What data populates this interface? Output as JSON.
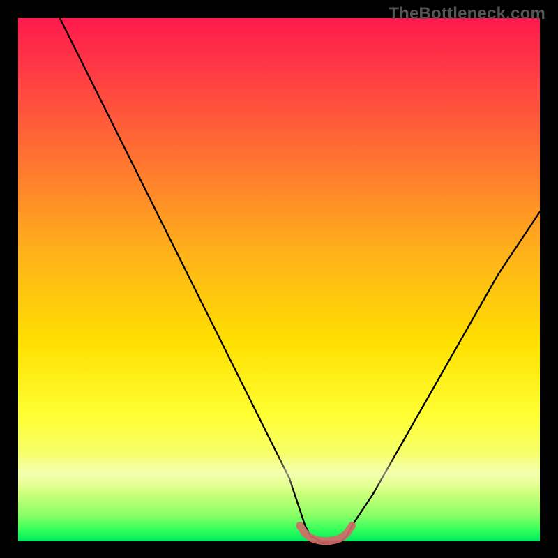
{
  "watermark": "TheBottleneck.com",
  "chart_data": {
    "type": "line",
    "title": "",
    "xlabel": "",
    "ylabel": "",
    "xlim": [
      0,
      100
    ],
    "ylim": [
      0,
      100
    ],
    "grid": false,
    "legend": false,
    "annotations": [
      {
        "text": "TheBottleneck.com",
        "position": "top-right"
      }
    ],
    "background_gradient_stops": [
      {
        "pct": 0,
        "color": "#ff1a4d"
      },
      {
        "pct": 28,
        "color": "#ff7730"
      },
      {
        "pct": 62,
        "color": "#ffe000"
      },
      {
        "pct": 90,
        "color": "#d8ff80"
      },
      {
        "pct": 100,
        "color": "#00e860"
      }
    ],
    "series": [
      {
        "name": "bottleneck-curve",
        "color": "#000000",
        "x": [
          8,
          12,
          16,
          20,
          24,
          28,
          32,
          36,
          40,
          44,
          48,
          52,
          54,
          55,
          56,
          58,
          60,
          62,
          63,
          64,
          68,
          72,
          76,
          80,
          84,
          88,
          92,
          96,
          100
        ],
        "values": [
          100,
          92,
          84,
          76,
          68,
          60,
          52,
          44,
          36,
          28,
          20,
          12,
          6,
          3,
          1,
          0,
          0,
          0,
          1,
          3,
          9,
          16,
          23,
          30,
          37,
          44,
          51,
          57,
          63
        ]
      },
      {
        "name": "optimal-band",
        "color": "#d46a6a",
        "x": [
          54,
          55,
          56,
          57,
          58,
          59,
          60,
          61,
          62,
          63,
          64
        ],
        "values": [
          3,
          1.5,
          0.7,
          0.3,
          0.1,
          0,
          0.1,
          0.3,
          0.7,
          1.5,
          3
        ]
      }
    ]
  }
}
